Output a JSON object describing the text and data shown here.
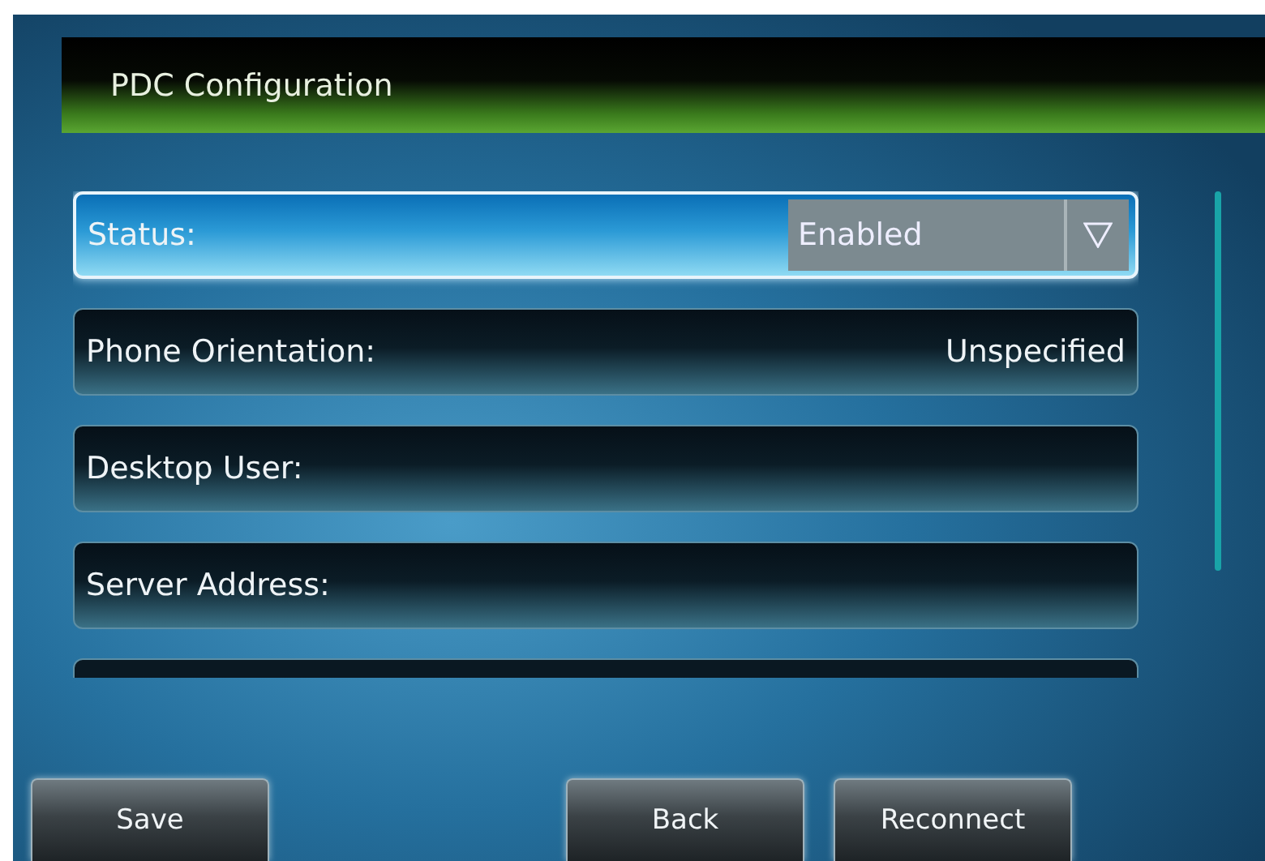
{
  "header": {
    "title": "PDC Configuration"
  },
  "settings": [
    {
      "kind": "dropdown",
      "label": "Status:",
      "value": "Enabled",
      "selected": true
    },
    {
      "kind": "text",
      "label": "Phone Orientation:",
      "value": "Unspecified",
      "selected": false
    },
    {
      "kind": "text",
      "label": "Desktop User:",
      "selected": false
    },
    {
      "kind": "text",
      "label": "Server Address:",
      "selected": false
    }
  ],
  "left_buttons": [
    "Save"
  ],
  "right_buttons": [
    "Back",
    "Reconnect"
  ]
}
